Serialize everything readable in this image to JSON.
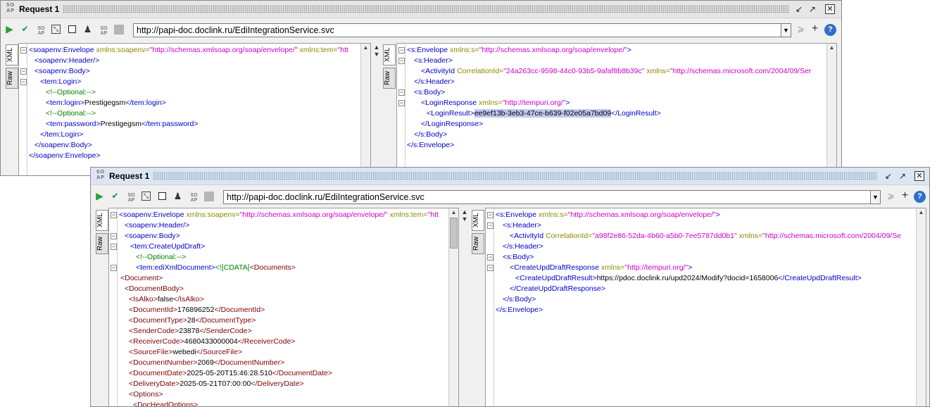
{
  "windows": [
    {
      "title": "Request 1",
      "url": "http://papi-doc.doclink.ru/EdiIntegrationService.svc",
      "tabs": {
        "xml": "XML",
        "raw": "Raw"
      },
      "request_lines": [
        [
          [
            "t",
            "<soapenv:Envelope "
          ],
          [
            "a",
            "xmlns:soapenv="
          ],
          [
            "v",
            "\"http://schemas.xmlsoap.org/soap/envelope/\""
          ],
          [
            "a",
            " xmlns:tem="
          ],
          [
            "v",
            "\"htt"
          ]
        ],
        [
          [
            "t",
            "<soapenv:Header/>"
          ]
        ],
        [
          [
            "t",
            "<soapenv:Body>"
          ]
        ],
        [
          [
            "t",
            "<tem:Login>"
          ]
        ],
        [
          [
            "c",
            "<!--Optional:-->"
          ]
        ],
        [
          [
            "t",
            "<tem:login>"
          ],
          [
            "x",
            "Prestigegsm"
          ],
          [
            "t",
            "</tem:login>"
          ]
        ],
        [
          [
            "c",
            "<!--Optional:-->"
          ]
        ],
        [
          [
            "t",
            "<tem:password>"
          ],
          [
            "x",
            "Prestigegsm"
          ],
          [
            "t",
            "</tem:password>"
          ]
        ],
        [
          [
            "t",
            "</tem:Login>"
          ]
        ],
        [
          [
            "t",
            "</soapenv:Body>"
          ]
        ],
        [
          [
            "t",
            "</soapenv:Envelope>"
          ]
        ]
      ],
      "response_lines": [
        [
          [
            "t",
            "<s:Envelope "
          ],
          [
            "a",
            "xmlns:s="
          ],
          [
            "v",
            "\"http://schemas.xmlsoap.org/soap/envelope/\""
          ],
          [
            "t",
            ">"
          ]
        ],
        [
          [
            "t",
            "<s:Header>"
          ]
        ],
        [
          [
            "t",
            "<ActivityId "
          ],
          [
            "a",
            "CorrelationId="
          ],
          [
            "v",
            "\"24a263cc-9598-44c0-93b5-9afaf8b8b39c\""
          ],
          [
            "a",
            " xmlns="
          ],
          [
            "v",
            "\"http://schemas.microsoft.com/2004/09/Ser"
          ]
        ],
        [
          [
            "t",
            "</s:Header>"
          ]
        ],
        [
          [
            "t",
            "<s:Body>"
          ]
        ],
        [
          [
            "t",
            "<LoginResponse "
          ],
          [
            "a",
            "xmlns="
          ],
          [
            "v",
            "\"http://tempuri.org/\""
          ],
          [
            "t",
            ">"
          ]
        ],
        [
          [
            "t",
            "<LoginResult>"
          ],
          [
            "hl",
            "ee9ef13b-3eb3-47ce-b639-f02e05a7bd09"
          ],
          [
            "t",
            "</LoginResult>"
          ]
        ],
        [
          [
            "t",
            "</LoginResponse>"
          ]
        ],
        [
          [
            "t",
            "</s:Body>"
          ]
        ],
        [
          [
            "t",
            "</s:Envelope>"
          ]
        ]
      ]
    },
    {
      "title": "Request 1",
      "url": "http://papi-doc.doclink.ru/EdiIntegrationService.svc",
      "tabs": {
        "xml": "XML",
        "raw": "Raw"
      },
      "request_lines": [
        [
          [
            "t",
            "<soapenv:Envelope "
          ],
          [
            "a",
            "xmlns:soapenv="
          ],
          [
            "v",
            "\"http://schemas.xmlsoap.org/soap/envelope/\""
          ],
          [
            "a",
            " xmlns:tem="
          ],
          [
            "v",
            "\"htt"
          ]
        ],
        [
          [
            "t",
            "<soapenv:Header/>"
          ]
        ],
        [
          [
            "t",
            "<soapenv:Body>"
          ]
        ],
        [
          [
            "t",
            "<tem:CreateUpdDraft>"
          ]
        ],
        [
          [
            "c",
            "<!--Optional:-->"
          ]
        ],
        [
          [
            "t",
            "<tem:ediXmlDocument>"
          ],
          [
            "c",
            "<![CDATA["
          ],
          [
            "b",
            "<Documents>"
          ]
        ],
        [
          [
            "b",
            "<Document>"
          ]
        ],
        [
          [
            "b",
            "<DocumentBody>"
          ]
        ],
        [
          [
            "b",
            "<IsAlko>"
          ],
          [
            "x",
            "false"
          ],
          [
            "b",
            "</IsAlko>"
          ]
        ],
        [
          [
            "b",
            "<DocumentId>"
          ],
          [
            "x",
            "176896252"
          ],
          [
            "b",
            "</DocumentId>"
          ]
        ],
        [
          [
            "b",
            "<DocumentType>"
          ],
          [
            "x",
            "28"
          ],
          [
            "b",
            "</DocumentType>"
          ]
        ],
        [
          [
            "b",
            "<SenderCode>"
          ],
          [
            "x",
            "23878"
          ],
          [
            "b",
            "</SenderCode>"
          ]
        ],
        [
          [
            "b",
            "<ReceiverCode>"
          ],
          [
            "x",
            "4680433000004"
          ],
          [
            "b",
            "</ReceiverCode>"
          ]
        ],
        [
          [
            "b",
            "<SourceFile>"
          ],
          [
            "x",
            "webedi"
          ],
          [
            "b",
            "</SourceFile>"
          ]
        ],
        [
          [
            "b",
            "<DocumentNumber>"
          ],
          [
            "x",
            "2069"
          ],
          [
            "b",
            "</DocumentNumber>"
          ]
        ],
        [
          [
            "b",
            "<DocumentDate>"
          ],
          [
            "x",
            "2025-05-20T15:46:28.510"
          ],
          [
            "b",
            "</DocumentDate>"
          ]
        ],
        [
          [
            "b",
            "<DeliveryDate>"
          ],
          [
            "x",
            "2025-05-21T07:00:00"
          ],
          [
            "b",
            "</DeliveryDate>"
          ]
        ],
        [
          [
            "b",
            "<Options>"
          ]
        ],
        [
          [
            "b",
            "<DocHeadOptions>"
          ]
        ]
      ],
      "response_lines": [
        [
          [
            "t",
            "<s:Envelope "
          ],
          [
            "a",
            "xmlns:s="
          ],
          [
            "v",
            "\"http://schemas.xmlsoap.org/soap/envelope/\""
          ],
          [
            "t",
            ">"
          ]
        ],
        [
          [
            "t",
            "<s:Header>"
          ]
        ],
        [
          [
            "t",
            "<ActivityId "
          ],
          [
            "a",
            "CorrelationId="
          ],
          [
            "v",
            "\"a98f2e86-52da-4b60-a5b0-7ee5787dd0b1\""
          ],
          [
            "a",
            " xmlns="
          ],
          [
            "v",
            "\"http://schemas.microsoft.com/2004/09/Se"
          ]
        ],
        [
          [
            "t",
            "</s:Header>"
          ]
        ],
        [
          [
            "t",
            "<s:Body>"
          ]
        ],
        [
          [
            "t",
            "<CreateUpdDraftResponse "
          ],
          [
            "a",
            "xmlns="
          ],
          [
            "v",
            "\"http://tempuri.org/\""
          ],
          [
            "t",
            ">"
          ]
        ],
        [
          [
            "t",
            "<CreateUpdDraftResult>"
          ],
          [
            "x",
            "https://pdoc.doclink.ru/upd2024/Modify?docid=1658006"
          ],
          [
            "t",
            "</CreateUpdDraftResult>"
          ]
        ],
        [
          [
            "t",
            "</CreateUpdDraftResponse>"
          ]
        ],
        [
          [
            "t",
            "</s:Body>"
          ]
        ],
        [
          [
            "t",
            "</s:Envelope>"
          ]
        ]
      ]
    }
  ]
}
